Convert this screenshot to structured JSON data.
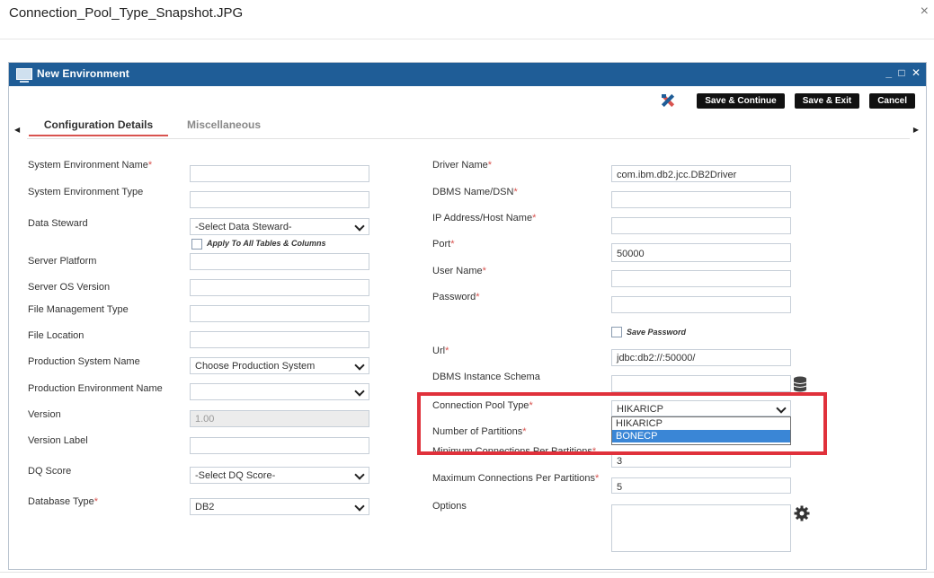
{
  "viewer": {
    "title": "Connection_Pool_Type_Snapshot.JPG",
    "close_symbol": "×"
  },
  "window": {
    "title": "New Environment",
    "controls": [
      "_",
      "□",
      "✕"
    ],
    "toolbar": {
      "tool_icon": "wrench-hammer-icon",
      "save_continue": "Save & Continue",
      "save_exit": "Save & Exit",
      "cancel": "Cancel"
    },
    "tabs": [
      {
        "label": "Configuration Details",
        "active": true
      },
      {
        "label": "Miscellaneous",
        "active": false
      }
    ]
  },
  "left_form": {
    "system_env_name": {
      "label": "System Environment Name",
      "required": "*",
      "value": ""
    },
    "system_env_type": {
      "label": "System Environment Type",
      "value": ""
    },
    "data_steward": {
      "label": "Data Steward",
      "value": "-Select Data Steward-",
      "checkbox_label": "Apply To All Tables & Columns"
    },
    "server_platform": {
      "label": "Server Platform",
      "value": ""
    },
    "server_os_version": {
      "label": "Server OS Version",
      "value": ""
    },
    "file_mgmt_type": {
      "label": "File Management Type",
      "value": ""
    },
    "file_location": {
      "label": "File Location",
      "value": ""
    },
    "production_system_name": {
      "label": "Production System Name",
      "value": "Choose Production System"
    },
    "production_env_name": {
      "label": "Production Environment Name",
      "value": ""
    },
    "version": {
      "label": "Version",
      "value": "1.00"
    },
    "version_label": {
      "label": "Version Label",
      "value": ""
    },
    "dq_score": {
      "label": "DQ Score",
      "value": "-Select DQ Score-"
    },
    "database_type": {
      "label": "Database Type",
      "required": "*",
      "value": "DB2"
    }
  },
  "right_form": {
    "driver_name": {
      "label": "Driver Name",
      "required": "*",
      "value": "com.ibm.db2.jcc.DB2Driver"
    },
    "dbms_name": {
      "label": "DBMS Name/DSN",
      "required": "*",
      "value": ""
    },
    "ip_address": {
      "label": "IP Address/Host Name",
      "required": "*",
      "value": ""
    },
    "port": {
      "label": "Port",
      "required": "*",
      "value": "50000"
    },
    "user_name": {
      "label": "User Name",
      "required": "*",
      "value": ""
    },
    "password": {
      "label": "Password",
      "required": "*",
      "value": "",
      "checkbox_label": "Save Password"
    },
    "url": {
      "label": "Url",
      "required": "*",
      "value": "jdbc:db2://:50000/"
    },
    "dbms_instance_schema": {
      "label": "DBMS Instance Schema",
      "value": "",
      "icon": "database-icon"
    },
    "connection_pool_type": {
      "label": "Connection Pool Type",
      "required": "*",
      "value": "HIKARICP",
      "options": [
        "HIKARICP",
        "BONECP"
      ],
      "highlighted_option": "BONECP"
    },
    "number_of_partitions": {
      "label": "Number of Partitions",
      "required": "*",
      "value": ""
    },
    "min_connections": {
      "label": "Minimum Connections Per Partitions",
      "required": "*",
      "value": "3"
    },
    "max_connections": {
      "label": "Maximum Connections Per Partitions",
      "required": "*",
      "value": "5"
    },
    "options": {
      "label": "Options",
      "value": "",
      "icon": "gear-icon"
    }
  },
  "colors": {
    "titlebar": "#1f5d97",
    "highlight": "#e0313b",
    "required": "#d9534f",
    "selected_option": "#3a86d6"
  }
}
